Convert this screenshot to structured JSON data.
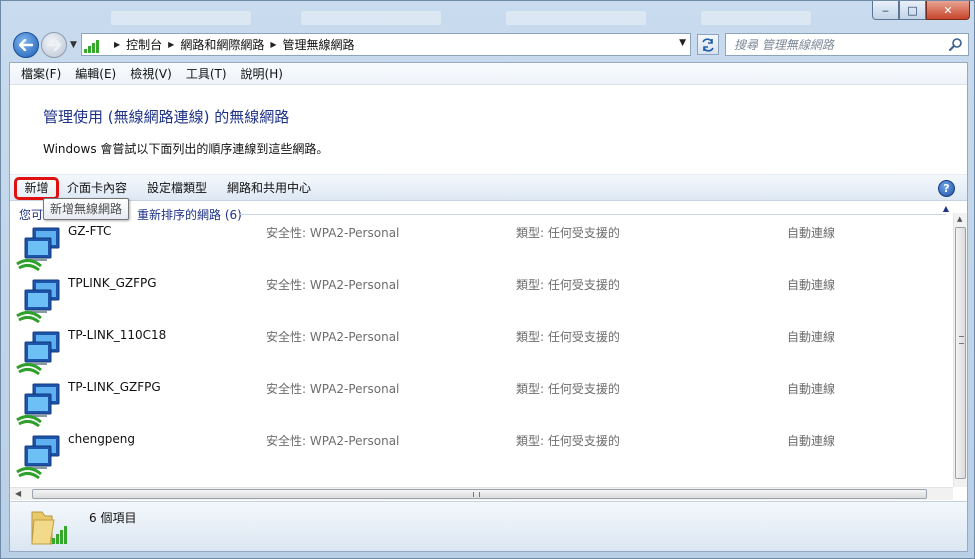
{
  "window": {
    "controls": {
      "minimize": "‒",
      "maximize": "□",
      "close": "✕"
    }
  },
  "address": {
    "crumbs": [
      "控制台",
      "網路和網際網路",
      "管理無線網路"
    ]
  },
  "search": {
    "placeholder": "搜尋 管理無線網路"
  },
  "menu": [
    "檔案(F)",
    "編輯(E)",
    "檢視(V)",
    "工具(T)",
    "說明(H)"
  ],
  "header": {
    "title": "管理使用 (無線網路連線) 的無線網路",
    "description": "Windows 會嘗試以下面列出的順序連線到這些網路。"
  },
  "toolbar": {
    "add_label": "新增",
    "adapter_label": "介面卡內容",
    "profile_type_label": "設定檔類型",
    "sharing_center_label": "網路和共用中心",
    "help": "?"
  },
  "tooltip": {
    "text": "新增無線網路"
  },
  "group": {
    "label_start": "您可",
    "label_end": "重新排序的網路 (6)"
  },
  "networks": [
    {
      "name": "GZ-FTC",
      "security": "安全性: WPA2-Personal",
      "type": "類型: 任何受支援的",
      "mode": "自動連線"
    },
    {
      "name": "TPLINK_GZFPG",
      "security": "安全性: WPA2-Personal",
      "type": "類型: 任何受支援的",
      "mode": "自動連線"
    },
    {
      "name": "TP-LINK_110C18",
      "security": "安全性: WPA2-Personal",
      "type": "類型: 任何受支援的",
      "mode": "自動連線"
    },
    {
      "name": "TP-LINK_GZFPG",
      "security": "安全性: WPA2-Personal",
      "type": "類型: 任何受支援的",
      "mode": "自動連線"
    },
    {
      "name": "chengpeng",
      "security": "安全性: WPA2-Personal",
      "type": "類型: 任何受支援的",
      "mode": "自動連線"
    }
  ],
  "details": {
    "count": "6 個項目"
  },
  "colors": {
    "title_blue": "#1e3287",
    "highlight_red": "#e01010",
    "signal_green": "#35a82b"
  },
  "icons": {
    "back": "back-arrow-icon",
    "forward": "forward-arrow-icon",
    "network": "wireless-network-icon",
    "search": "search-icon",
    "refresh": "refresh-icon",
    "help": "help-icon"
  }
}
